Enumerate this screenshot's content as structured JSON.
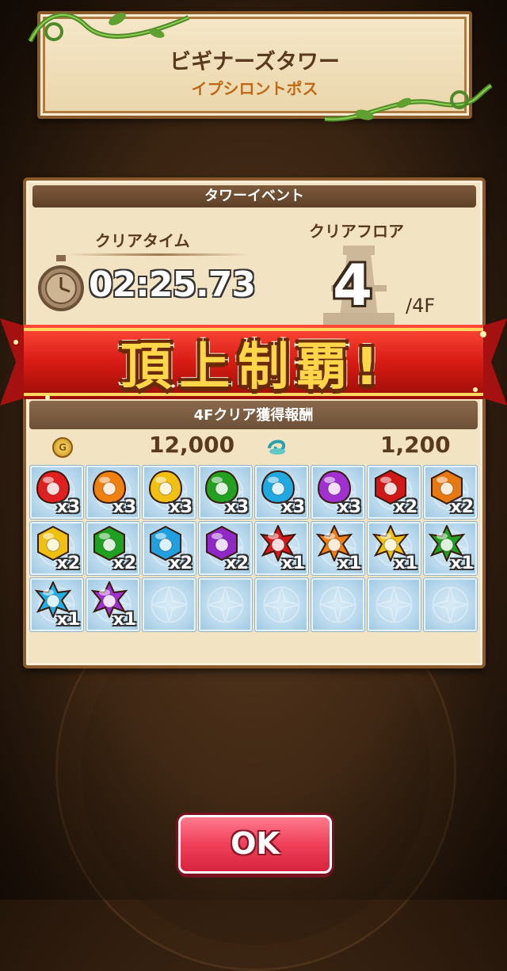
{
  "header": {
    "title": "ビギナーズタワー",
    "subtitle": "イプシロントポス"
  },
  "panel": {
    "title": "タワーイベント",
    "clear_time_label": "クリアタイム",
    "clear_time": "02:25.73",
    "clear_floor_label": "クリアフロア",
    "clear_floor": "4",
    "floor_total": "/4F"
  },
  "banner": {
    "text": "頂上制覇!"
  },
  "rewards": {
    "header": "4Fクリア獲得報酬",
    "gold_icon_letter": "G",
    "gold": "12,000",
    "spirit": "1,200",
    "items": [
      {
        "icon": "red-round-gem-icon",
        "shape": "round",
        "color": "#e02020",
        "qty": "x3"
      },
      {
        "icon": "orange-round-gem-icon",
        "shape": "round",
        "color": "#f08010",
        "qty": "x3"
      },
      {
        "icon": "yellow-round-gem-icon",
        "shape": "round",
        "color": "#f2c010",
        "qty": "x3"
      },
      {
        "icon": "green-round-gem-icon",
        "shape": "round",
        "color": "#22a020",
        "qty": "x3"
      },
      {
        "icon": "cyan-round-gem-icon",
        "shape": "round",
        "color": "#20a8e0",
        "qty": "x3"
      },
      {
        "icon": "purple-round-gem-icon",
        "shape": "round",
        "color": "#a030d0",
        "qty": "x3"
      },
      {
        "icon": "red-hex-gem-icon",
        "shape": "hex",
        "color": "#d01818",
        "qty": "x2"
      },
      {
        "icon": "orange-hex-gem-icon",
        "shape": "hex",
        "color": "#e87810",
        "qty": "x2"
      },
      {
        "icon": "yellow-hex-gem-icon",
        "shape": "hex",
        "color": "#f0c010",
        "qty": "x2"
      },
      {
        "icon": "green-hex-gem-icon",
        "shape": "hex",
        "color": "#20a020",
        "qty": "x2"
      },
      {
        "icon": "cyan-hex-gem-icon",
        "shape": "hex",
        "color": "#20a0e0",
        "qty": "x2"
      },
      {
        "icon": "purple-hex-gem-icon",
        "shape": "hex",
        "color": "#9028c8",
        "qty": "x2"
      },
      {
        "icon": "red-star-gem-icon",
        "shape": "star",
        "color": "#d81818",
        "qty": "x1"
      },
      {
        "icon": "orange-star-gem-icon",
        "shape": "star",
        "color": "#f08010",
        "qty": "x1"
      },
      {
        "icon": "yellow-star-gem-icon",
        "shape": "star",
        "color": "#f0c010",
        "qty": "x1"
      },
      {
        "icon": "green-star-gem-icon",
        "shape": "star",
        "color": "#20a020",
        "qty": "x1"
      },
      {
        "icon": "cyan-star-gem-icon",
        "shape": "star",
        "color": "#20b0e8",
        "qty": "x1"
      },
      {
        "icon": "purple-star-gem-icon",
        "shape": "star",
        "color": "#a030d0",
        "qty": "x1"
      }
    ],
    "total_slots": 24
  },
  "ok_button": {
    "label": "OK"
  },
  "colors": {
    "accent_red": "#f0405a",
    "gold_text": "#ffd54a",
    "panel_bg": "#f2e3c3"
  }
}
